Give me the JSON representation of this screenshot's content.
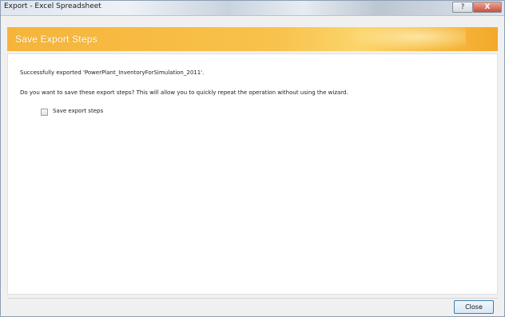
{
  "window": {
    "title": "Export - Excel Spreadsheet",
    "help_glyph": "?",
    "close_glyph": "X"
  },
  "header": {
    "title": "Save Export Steps",
    "accent_color": "#f6b43a"
  },
  "body": {
    "success_message": "Successfully exported 'PowerPlant_InventoryForSimulation_2011'.",
    "prompt": "Do you want to save these export steps? This will allow you to quickly repeat the operation without using the wizard.",
    "save_checkbox": {
      "label": "Save export steps",
      "checked": false
    }
  },
  "footer": {
    "close_label": "Close"
  }
}
